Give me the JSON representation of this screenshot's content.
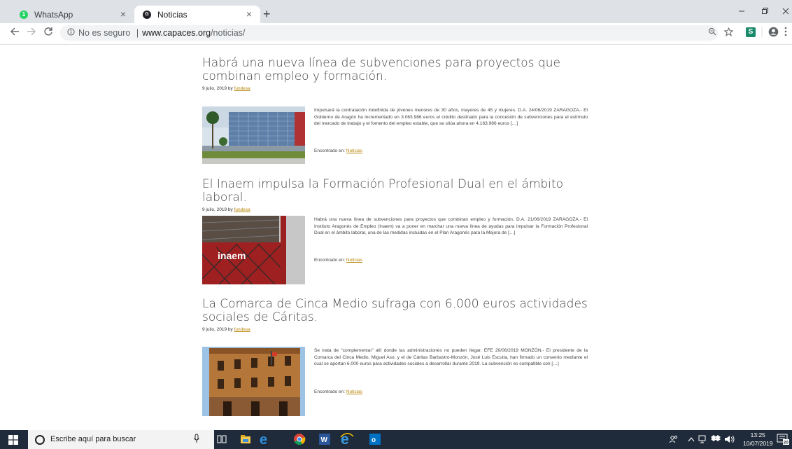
{
  "browser": {
    "tabs": [
      {
        "title": "WhatsApp",
        "favicon_color": "#25d366",
        "favicon_glyph": "1"
      },
      {
        "title": "Noticias",
        "favicon_color": "#202124",
        "favicon_glyph": "G"
      }
    ],
    "close_glyph": "×",
    "new_tab_glyph": "+",
    "omnibox": {
      "security": "No es seguro",
      "separator": "|",
      "domain": "www.capaces.org",
      "path": "/noticias/"
    },
    "extension_label": "S"
  },
  "posts": [
    {
      "title": "Habrá una nueva línea de subvenciones para proyectos que combinan empleo y formación.",
      "date": "9 julio, 2019",
      "by": "by",
      "author": "fundesa",
      "excerpt": "Impulsará la contratación indefinida de jóvenes menores de 30 años, mayores de 45 y mujeres. D.A. 24/06/2019 ZARAGOZA.- El Gobierno de Aragón ha incrementado en 3.063.986 euros el crédito destinado para la concesión de subvenciones para el estímulo del mercado de trabajo y el fomento del empleo estable, que se sitúa ahora en 4.163.986 euros […]",
      "found_label": "Encontrado en:",
      "category": "Noticias"
    },
    {
      "title": "El Inaem impulsa la Formación Profesional Dual en el ámbito laboral.",
      "date": "9 julio, 2019",
      "by": "by",
      "author": "fundesa",
      "excerpt": "Habrá una nueva línea de subvenciones para proyectos que combinan empleo y formación. D.A. 21/06/2019 ZARAGOZA.- El Instituto Aragonés de Empleo (Inaem) va a poner en marchar una nueva línea de ayudas para impulsar la Formación Profesional Dual en el ámbito laboral, una de las medidas incluidas en el Plan Aragonés para la Mejora de […]",
      "found_label": "Encontrado en:",
      "category": "Noticias",
      "image_text": "inaem"
    },
    {
      "title": "La Comarca de Cinca Medio sufraga con 6.000 euros actividades sociales de Cáritas.",
      "date": "9 julio, 2019",
      "by": "by",
      "author": "fundesa",
      "excerpt": "Se trata de “complementar” allí donde las administraciones no pueden llegar. EFE 20/06/2019 MONZÓN.- El presidente de la Comarca del Cinca Medio, Miguel Aso, y el de Cáritas Barbastro-Monzón, José Luis Escutia, han firmado un convenio mediante el cual se aportan 6.000 euros para actividades sociales a desarrollar durante 2019. La subvención es compatible con […]",
      "found_label": "Encontrado en:",
      "category": "Noticias"
    }
  ],
  "taskbar": {
    "search_placeholder": "Escribe aquí para buscar",
    "time": "13:25",
    "date": "10/07/2019",
    "notification_count": "20"
  }
}
